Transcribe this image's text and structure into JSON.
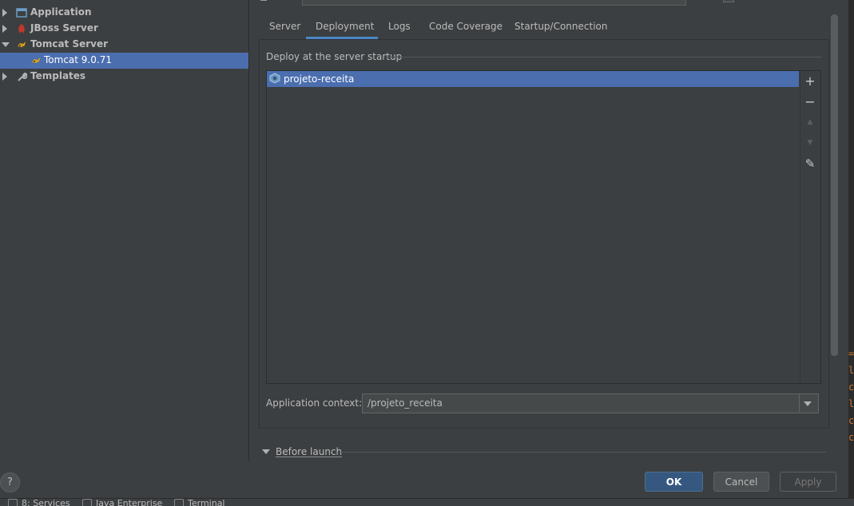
{
  "tree": {
    "items": [
      {
        "label": "Application",
        "icon": "application-icon",
        "expanded": false
      },
      {
        "label": "JBoss Server",
        "icon": "jboss-icon",
        "expanded": false
      },
      {
        "label": "Tomcat Server",
        "icon": "tomcat-icon",
        "expanded": true
      },
      {
        "label": "Tomcat 9.0.71",
        "icon": "tomcat-icon",
        "selected": true
      },
      {
        "label": "Templates",
        "icon": "wrench-icon",
        "expanded": false
      }
    ]
  },
  "tabs": [
    {
      "label": "Server"
    },
    {
      "label": "Deployment",
      "active": true
    },
    {
      "label": "Logs"
    },
    {
      "label": "Code Coverage"
    },
    {
      "label": "Startup/Connection"
    }
  ],
  "deploy": {
    "group_title": "Deploy at the server startup",
    "items": [
      "projeto-receita"
    ],
    "side_buttons": {
      "add": "+",
      "remove": "−",
      "up": "▲",
      "down": "▼",
      "edit": "✎"
    }
  },
  "context": {
    "label": "Application context:",
    "value": "/projeto_receita"
  },
  "before_launch": {
    "label": "Before launch"
  },
  "footer": {
    "help": "?",
    "ok": "OK",
    "cancel": "Cancel",
    "apply": "Apply"
  },
  "bottom_bar": {
    "items": [
      "8: Services",
      "Java Enterprise",
      "Terminal"
    ]
  },
  "editor_strip": {
    "chars": [
      "=A",
      "la",
      "co",
      "la",
      "co",
      "co"
    ]
  },
  "colors": {
    "selection": "#4b6eaf",
    "ok_button": "#365880",
    "background": "#3c3f41",
    "tab_underline": "#4a88c7"
  }
}
